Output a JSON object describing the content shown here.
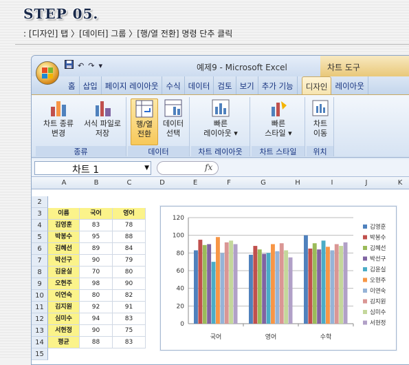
{
  "header": {
    "step": "STEP 05.",
    "instruction": ": [디자인] 탭 〉[데이터] 그룹 〉[행/열 전환] 명령 단추 클릭"
  },
  "window": {
    "title": "예제9 - Microsoft Excel",
    "context_title": "차트 도구",
    "qat_save": "save-icon",
    "qat_undo": "↶",
    "qat_redo": "↷",
    "qat_more": "▾"
  },
  "tabs": [
    {
      "label": "홈"
    },
    {
      "label": "삽입"
    },
    {
      "label": "페이지 레이아웃"
    },
    {
      "label": "수식"
    },
    {
      "label": "데이터"
    },
    {
      "label": "검토"
    },
    {
      "label": "보기"
    },
    {
      "label": "추가 기능"
    },
    {
      "label": "디자인"
    },
    {
      "label": "레이아웃"
    }
  ],
  "ribbon": {
    "groups": [
      {
        "label": "종류",
        "buttons": [
          "차트 종류\n변경",
          "서식 파일로\n저장"
        ]
      },
      {
        "label": "데이터",
        "buttons": [
          "행/열\n전환",
          "데이터\n선택"
        ]
      },
      {
        "label": "차트 레이아웃",
        "buttons": [
          "빠른\n레이아웃 ▾"
        ]
      },
      {
        "label": "차트 스타일",
        "buttons": [
          "빠른\n스타일 ▾"
        ]
      },
      {
        "label": "위치",
        "buttons": [
          "차트\n이동"
        ]
      }
    ]
  },
  "formula_bar": {
    "namebox": "차트 1",
    "fx": "fx"
  },
  "columns": [
    "A",
    "B",
    "C",
    "D",
    "E",
    "F",
    "G",
    "H",
    "I",
    "J",
    "K"
  ],
  "rows": [
    "2",
    "3",
    "4",
    "5",
    "6",
    "7",
    "8",
    "9",
    "10",
    "11",
    "12",
    "13",
    "14",
    "15"
  ],
  "table": {
    "headers": [
      "이름",
      "국어",
      "영어"
    ],
    "records": [
      [
        "김영훈",
        "83",
        "78"
      ],
      [
        "박봉수",
        "95",
        "88"
      ],
      [
        "김혜선",
        "89",
        "84"
      ],
      [
        "박선구",
        "90",
        "79"
      ],
      [
        "김윤실",
        "70",
        "80"
      ],
      [
        "오현주",
        "98",
        "90"
      ],
      [
        "이연숙",
        "80",
        "82"
      ],
      [
        "김지원",
        "92",
        "91"
      ],
      [
        "심미수",
        "94",
        "83"
      ],
      [
        "서현정",
        "90",
        "75"
      ],
      [
        "평균",
        "88",
        "83"
      ]
    ]
  },
  "chart_data": {
    "type": "bar",
    "categories": [
      "국어",
      "영어",
      "수학"
    ],
    "ylim": [
      0,
      120
    ],
    "yticks": [
      "0",
      "20",
      "40",
      "60",
      "80",
      "100",
      "120"
    ],
    "grid": true,
    "legend_position": "right",
    "series": [
      {
        "name": "김영훈",
        "values": [
          83,
          78,
          100
        ],
        "color": "#4f81bd"
      },
      {
        "name": "박봉수",
        "values": [
          95,
          88,
          85
        ],
        "color": "#c0504d"
      },
      {
        "name": "김혜선",
        "values": [
          89,
          84,
          91
        ],
        "color": "#9bbb59"
      },
      {
        "name": "박선구",
        "values": [
          90,
          79,
          84
        ],
        "color": "#8064a2"
      },
      {
        "name": "김윤실",
        "values": [
          70,
          80,
          94
        ],
        "color": "#4bacc6"
      },
      {
        "name": "오현주",
        "values": [
          98,
          90,
          87
        ],
        "color": "#f79646"
      },
      {
        "name": "이연숙",
        "values": [
          80,
          82,
          83
        ],
        "color": "#95b3d7"
      },
      {
        "name": "김지원",
        "values": [
          92,
          91,
          90
        ],
        "color": "#da9694"
      },
      {
        "name": "심미수",
        "values": [
          94,
          83,
          88
        ],
        "color": "#c4d79b"
      },
      {
        "name": "서현정",
        "values": [
          90,
          75,
          92
        ],
        "color": "#b1a0c7"
      }
    ]
  }
}
